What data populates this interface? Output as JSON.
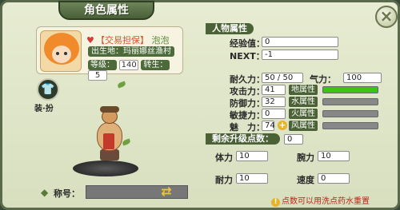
{
  "window": {
    "title": "角色属性"
  },
  "profile": {
    "trade_tag": "【交易担保】",
    "name": "泡泡",
    "origin_label": "出生地：",
    "origin_value": "玛丽娜丝渔村",
    "level_label": "等级：",
    "level_value": "140",
    "rebirth_label": "转生：",
    "rebirth_value": "5"
  },
  "equip": {
    "label": "装·扮"
  },
  "name_row": {
    "label": "称号：",
    "value": ""
  },
  "sections": {
    "char_attr": "人物属性",
    "remaining": "剩余升级点数：",
    "remaining_value": "0"
  },
  "exp": {
    "exp_label": "经验值：",
    "exp_value": "0",
    "next_label": "NEXT：",
    "next_value": "-1"
  },
  "stats": {
    "durability_label": "耐久力：",
    "durability_value": "50 / 50",
    "qi_label": "气力：",
    "qi_value": "100",
    "attack_label": "攻击力：",
    "attack_value": "41",
    "defense_label": "防御力：",
    "defense_value": "32",
    "agility_label": "敏捷力：",
    "agility_value": "0",
    "charm_label": "魅　力：",
    "charm_value": "74"
  },
  "elements": [
    {
      "label": "地属性",
      "level": 1.0
    },
    {
      "label": "水属性",
      "level": 0
    },
    {
      "label": "火属性",
      "level": 0
    },
    {
      "label": "风属性",
      "level": 0
    }
  ],
  "upgrade": {
    "stamina_label": "体力",
    "stamina_value": "10",
    "arm_label": "腕力",
    "arm_value": "10",
    "endurance_label": "耐力",
    "endurance_value": "10",
    "speed_label": "速度",
    "speed_value": "0"
  },
  "notice": "点数可以用洗点药水重置",
  "colors": {
    "accent": "#4a6236",
    "element_fill": "#3cc414",
    "notice": "#b8281a"
  }
}
